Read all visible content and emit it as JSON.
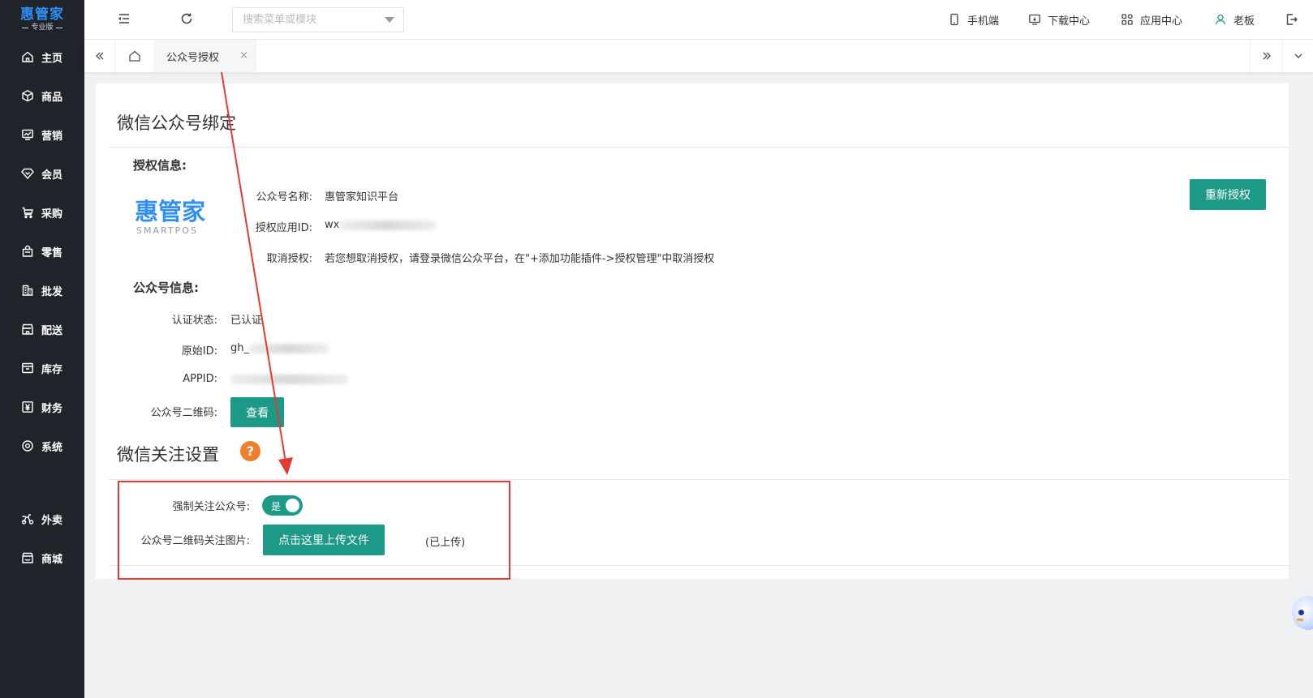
{
  "app": {
    "brand": "惠管家",
    "edition": "专业版"
  },
  "sidebar": {
    "items": [
      {
        "label": "主页",
        "icon": "home-icon"
      },
      {
        "label": "商品",
        "icon": "box-icon"
      },
      {
        "label": "营销",
        "icon": "chart-icon"
      },
      {
        "label": "会员",
        "icon": "diamond-icon"
      },
      {
        "label": "采购",
        "icon": "cart-icon"
      },
      {
        "label": "零售",
        "icon": "bag-icon"
      },
      {
        "label": "批发",
        "icon": "building-icon"
      },
      {
        "label": "配送",
        "icon": "store-icon"
      },
      {
        "label": "库存",
        "icon": "warehouse-icon"
      },
      {
        "label": "财务",
        "icon": "yen-icon"
      },
      {
        "label": "系统",
        "icon": "settings-icon"
      }
    ],
    "extra_items": [
      {
        "label": "外卖",
        "icon": "delivery-icon"
      },
      {
        "label": "商城",
        "icon": "shop-icon"
      }
    ]
  },
  "topbar": {
    "search_placeholder": "搜索菜单或模块",
    "mobile": "手机端",
    "download": "下载中心",
    "apps": "应用中心",
    "user": "老板"
  },
  "tabs": {
    "active": "公众号授权",
    "close": "×"
  },
  "binding": {
    "title": "微信公众号绑定",
    "auth_info_title": "授权信息:",
    "logo_text": "惠管家",
    "logo_sub": "SMARTPOS",
    "name_label": "公众号名称:",
    "name_value": "惠管家知识平台",
    "appid_label": "授权应用ID:",
    "appid_value": "wx",
    "cancel_label": "取消授权:",
    "cancel_value": "若您想取消授权，请登录微信公众平台，在\"+添加功能插件->授权管理\"中取消授权",
    "reauth_button": "重新授权",
    "account_info_title": "公众号信息:",
    "status_label": "认证状态:",
    "status_value": "已认证",
    "origin_label": "原始ID:",
    "origin_value": "gh_",
    "appid2_label": "APPID:",
    "qrcode_label": "公众号二维码:",
    "view_button": "查看"
  },
  "follow": {
    "title": "微信关注设置",
    "help": "?",
    "force_label": "强制关注公众号:",
    "force_value": "是",
    "qr_label": "公众号二维码关注图片:",
    "upload_button": "点击这里上传文件",
    "upload_status": "(已上传)"
  },
  "colors": {
    "sidebar_bg": "#20232a",
    "accent": "#1c9a87",
    "brand_blue": "#2e8ff5",
    "help_orange": "#f07e2a",
    "annotation_red": "#e53935"
  }
}
